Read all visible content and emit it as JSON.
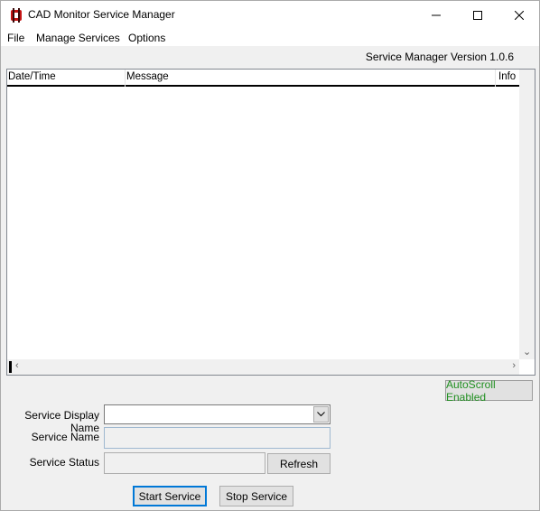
{
  "window": {
    "title": "CAD Monitor Service Manager",
    "icon": "cad-app-icon",
    "controls": [
      "minimize-icon",
      "maximize-icon",
      "close-icon"
    ]
  },
  "menu": {
    "items": [
      {
        "label": "File"
      },
      {
        "label": "Manage Services"
      },
      {
        "label": "Options"
      }
    ]
  },
  "version_label": "Service Manager Version 1.0.6",
  "log": {
    "columns": [
      "Date/Time",
      "Message",
      "Info"
    ],
    "rows": []
  },
  "autoscroll": {
    "label": "AutoScroll Enabled",
    "color": "#1f8f1f"
  },
  "form": {
    "display_name_label": "Service Display Name",
    "display_name_value": "",
    "service_name_label": "Service Name",
    "service_name_value": "",
    "service_status_label": "Service Status",
    "service_status_value": "",
    "refresh_label": "Refresh"
  },
  "actions": {
    "start_label": "Start Service",
    "stop_label": "Stop Service",
    "accent": "#0078d7"
  }
}
